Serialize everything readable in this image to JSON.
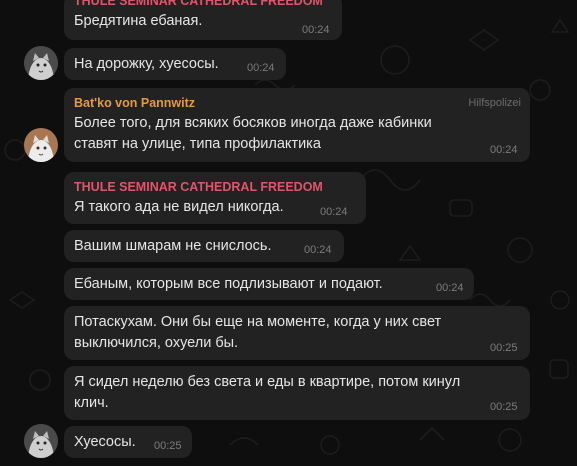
{
  "messages": [
    {
      "sender": "THULE SEMINAR CATHEDRAL FREEDOM",
      "text": "Бредятина ебаная.",
      "time": "00:24"
    },
    {
      "text": "На дорожку, хуесосы.",
      "time": "00:24"
    },
    {
      "sender": "Bat'ko von Pannwitz",
      "badge": "Hilfspolizei",
      "lines": [
        "Более того, для всяких босяков иногда даже кабинки",
        "ставят на улице, типа профилактика"
      ],
      "time": "00:24"
    },
    {
      "sender": "THULE SEMINAR CATHEDRAL FREEDOM",
      "text": "Я такого ада не видел никогда.",
      "time": "00:24"
    },
    {
      "text": "Вашим шмарам не снислось.",
      "time": "00:24"
    },
    {
      "text": "Ебаным, которым все подлизывают и подают.",
      "time": "00:24"
    },
    {
      "lines": [
        "Потаскухам. Они бы еще на моменте, когда у них свет",
        "выключился, охуели бы."
      ],
      "time": "00:25"
    },
    {
      "lines": [
        "Я сидел неделю без света и еды в квартире, потом кинул",
        "клич."
      ],
      "time": "00:25"
    },
    {
      "text": "Хуесосы.",
      "time": "00:25"
    }
  ],
  "colors": {
    "background": "#0e0e0e",
    "bubble": "#222222",
    "sender_thule": "#e0556a",
    "sender_batko": "#e59a3b",
    "text": "#e6e6e6",
    "time": "#7b7b7b"
  },
  "icons": {
    "avatar_thule": "cat-avatar",
    "avatar_batko": "cat-avatar"
  }
}
